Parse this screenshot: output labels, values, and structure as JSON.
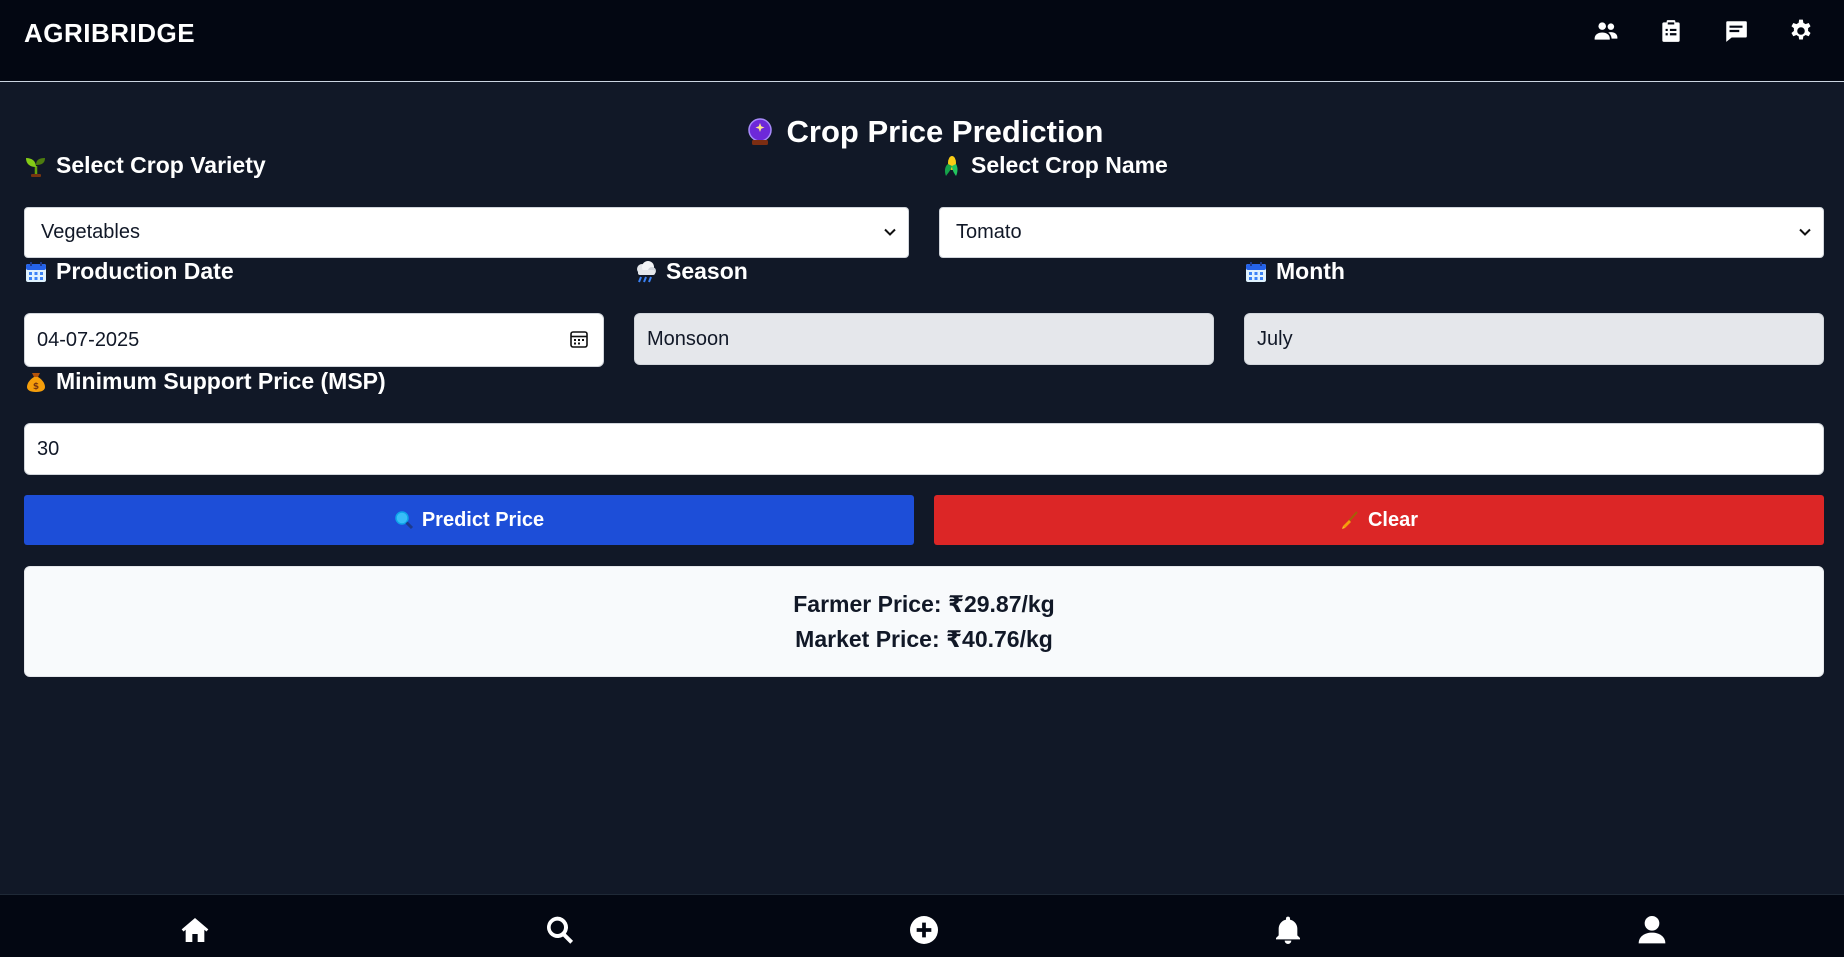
{
  "app": {
    "brand": "AGRIBRIDGE"
  },
  "header": {
    "icons": [
      "users-icon",
      "clipboard-icon",
      "chat-icon",
      "gear-icon"
    ]
  },
  "page": {
    "title": "Crop Price Prediction",
    "title_icon": "crystal-ball-icon"
  },
  "form": {
    "crop_variety": {
      "label": "Select Crop Variety",
      "icon": "seedling-icon",
      "value": "Vegetables"
    },
    "crop_name": {
      "label": "Select Crop Name",
      "icon": "corn-icon",
      "value": "Tomato"
    },
    "production_date": {
      "label": "Production Date",
      "icon": "calendar-icon",
      "value": "04-07-2025"
    },
    "season": {
      "label": "Season",
      "icon": "rain-cloud-icon",
      "value": "Monsoon"
    },
    "month": {
      "label": "Month",
      "icon": "calendar-icon",
      "value": "July"
    },
    "msp": {
      "label": "Minimum Support Price (MSP)",
      "icon": "money-bag-icon",
      "value": "30"
    }
  },
  "actions": {
    "predict_label": "Predict Price",
    "predict_icon": "magnifier-icon",
    "clear_label": "Clear",
    "clear_icon": "broom-icon"
  },
  "result": {
    "farmer_price": "Farmer Price: ₹29.87/kg",
    "market_price": "Market Price: ₹40.76/kg"
  },
  "bottom_nav": [
    "home-icon",
    "search-icon",
    "add-icon",
    "bell-icon",
    "profile-icon"
  ],
  "colors": {
    "background": "#111827",
    "header": "#030712",
    "predict": "#1d4ed8",
    "clear": "#dc2626",
    "result_bg": "#f8fafc"
  }
}
